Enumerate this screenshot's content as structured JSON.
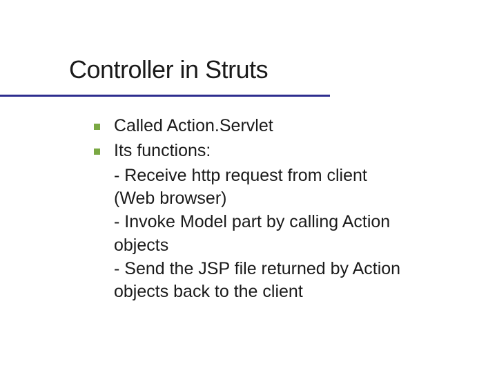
{
  "slide": {
    "title": "Controller in Struts",
    "bullets": [
      {
        "text": "Called Action.Servlet"
      },
      {
        "text": "Its functions:"
      }
    ],
    "sublines": [
      "- Receive http request from client",
      "(Web browser)",
      "- Invoke Model part by calling Action",
      "objects",
      "- Send the JSP file returned by Action",
      "objects back to the client"
    ]
  }
}
